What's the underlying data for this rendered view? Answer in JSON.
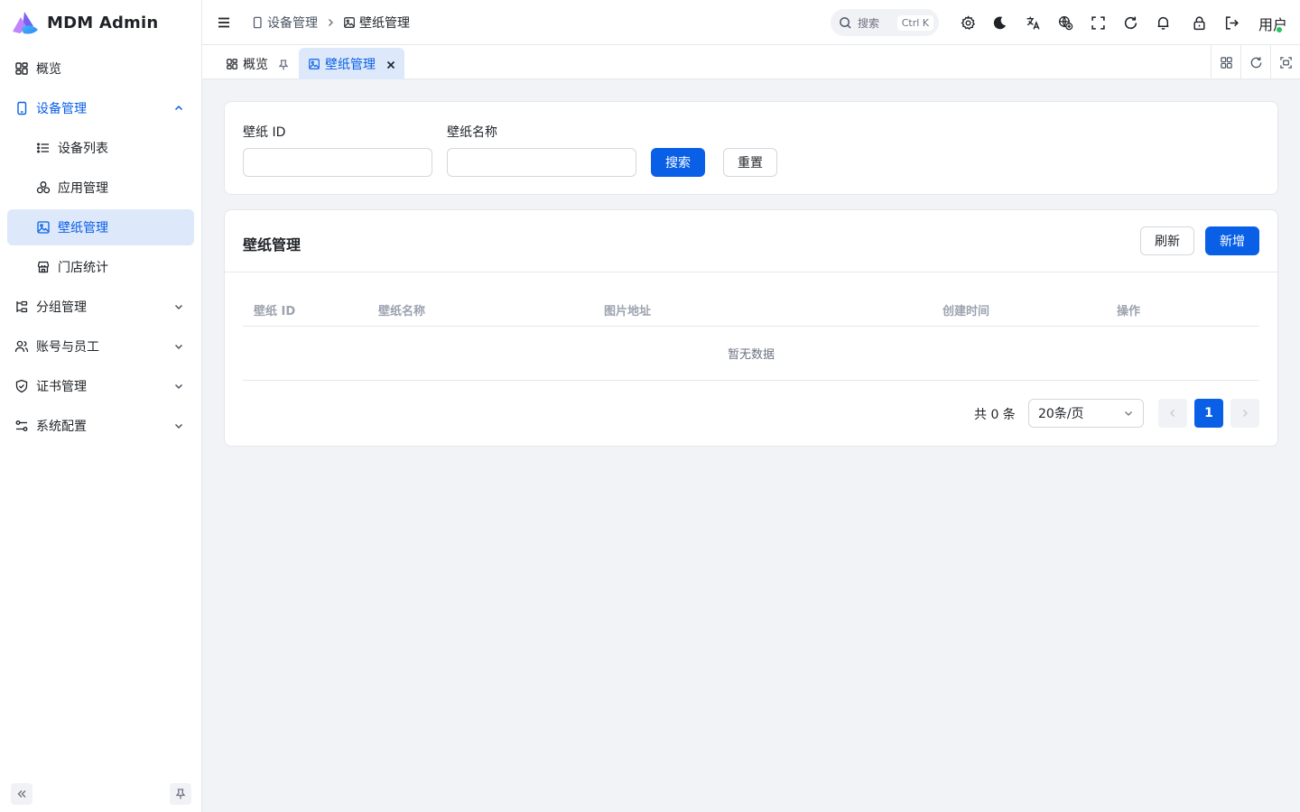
{
  "app": {
    "title": "MDM Admin"
  },
  "sidebar": {
    "items": [
      {
        "label": "概览",
        "icon": "dashboard-icon"
      },
      {
        "label": "设备管理",
        "icon": "tablet-icon",
        "expanded": true,
        "active_parent": true
      },
      {
        "label": "设备列表",
        "icon": "list-icon"
      },
      {
        "label": "应用管理",
        "icon": "apps-icon"
      },
      {
        "label": "壁纸管理",
        "icon": "image-icon",
        "active": true
      },
      {
        "label": "门店统计",
        "icon": "store-icon"
      },
      {
        "label": "分组管理",
        "icon": "group-icon",
        "expanded": false
      },
      {
        "label": "账号与员工",
        "icon": "users-icon",
        "expanded": false
      },
      {
        "label": "证书管理",
        "icon": "shield-icon",
        "expanded": false
      },
      {
        "label": "系统配置",
        "icon": "settings-sliders-icon",
        "expanded": false
      }
    ]
  },
  "header": {
    "breadcrumb": [
      "设备管理",
      "壁纸管理"
    ],
    "search": {
      "placeholder": "搜索",
      "shortcut": "Ctrl K"
    },
    "user_label": "用户"
  },
  "tabs": [
    {
      "label": "概览",
      "pinned": true
    },
    {
      "label": "壁纸管理",
      "active": true
    }
  ],
  "filters": {
    "wallpaper_id_label": "壁纸 ID",
    "wallpaper_id_value": "",
    "wallpaper_name_label": "壁纸名称",
    "wallpaper_name_value": "",
    "search_button": "搜索",
    "reset_button": "重置"
  },
  "table": {
    "title": "壁纸管理",
    "refresh_button": "刷新",
    "add_button": "新增",
    "columns": [
      "壁纸 ID",
      "壁纸名称",
      "图片地址",
      "创建时间",
      "操作"
    ],
    "rows": [],
    "empty_text": "暂无数据"
  },
  "pagination": {
    "total_text": "共 0 条",
    "page_size": "20条/页",
    "current_page": "1"
  },
  "colors": {
    "primary": "#0960e6",
    "active_bg": "#dde8fb",
    "page_bg": "#f1f3f6",
    "online_dot": "#22c55e"
  }
}
